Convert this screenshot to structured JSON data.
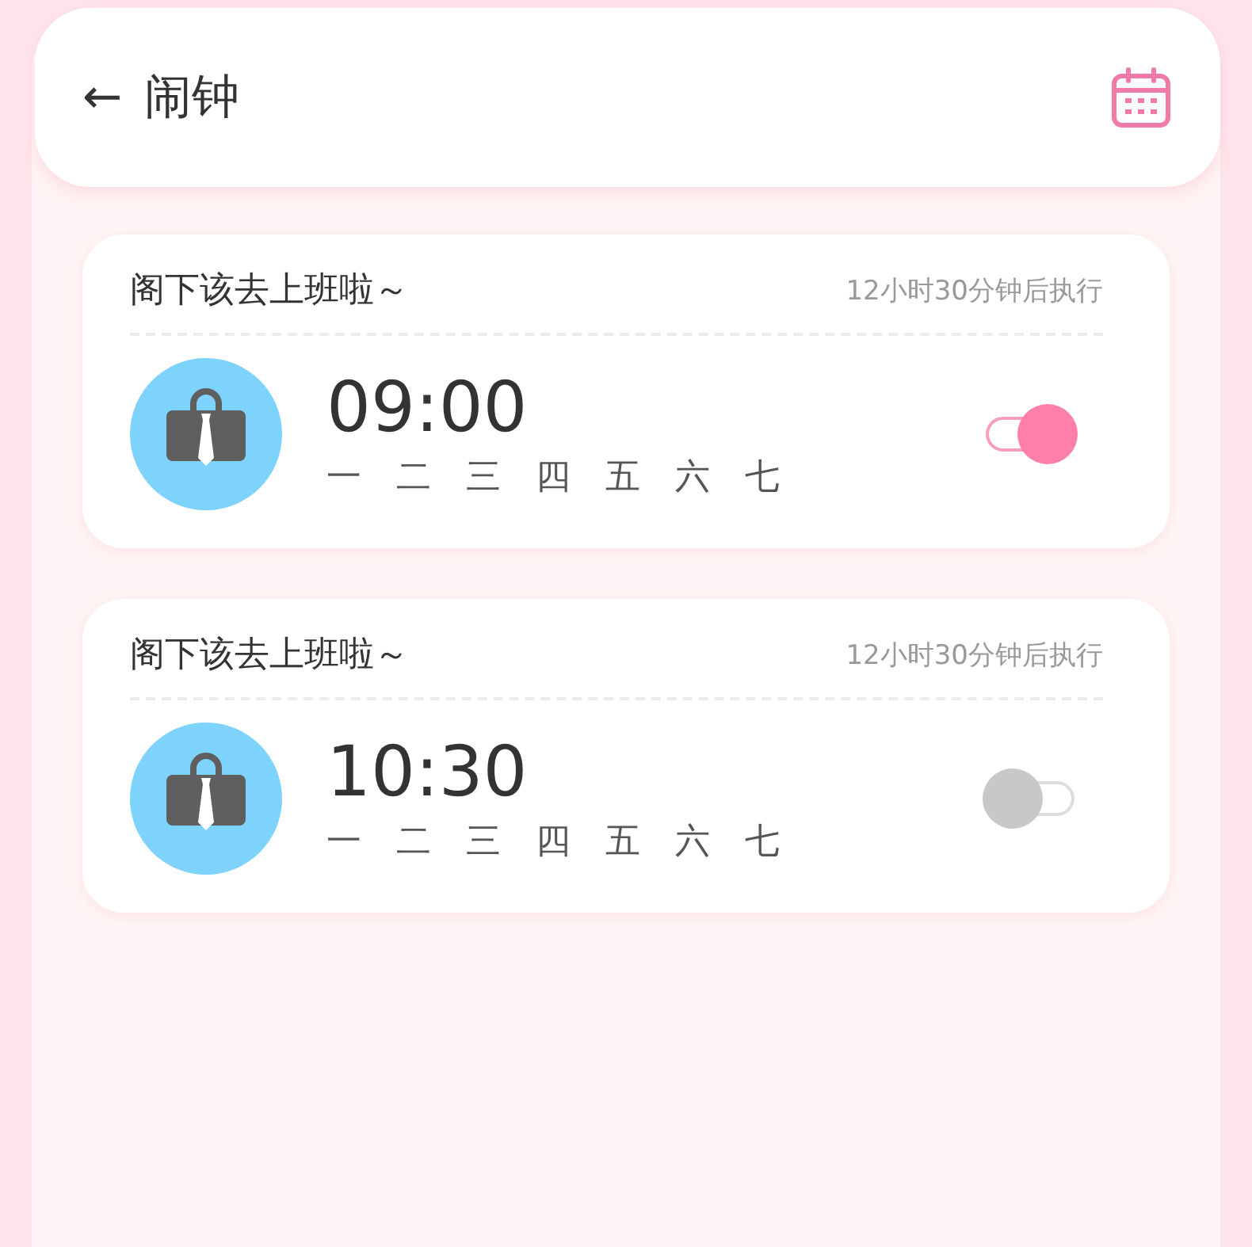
{
  "header": {
    "back": "←",
    "title": "闹钟"
  },
  "alarms": [
    {
      "label": "阁下该去上班啦～",
      "countdown": "12小时30分钟后执行",
      "time": "09:00",
      "days": [
        "一",
        "二",
        "三",
        "四",
        "五",
        "六",
        "七"
      ],
      "on": true
    },
    {
      "label": "阁下该去上班啦～",
      "countdown": "12小时30分钟后执行",
      "time": "10:30",
      "days": [
        "一",
        "二",
        "三",
        "四",
        "五",
        "六",
        "七"
      ],
      "on": false
    }
  ]
}
